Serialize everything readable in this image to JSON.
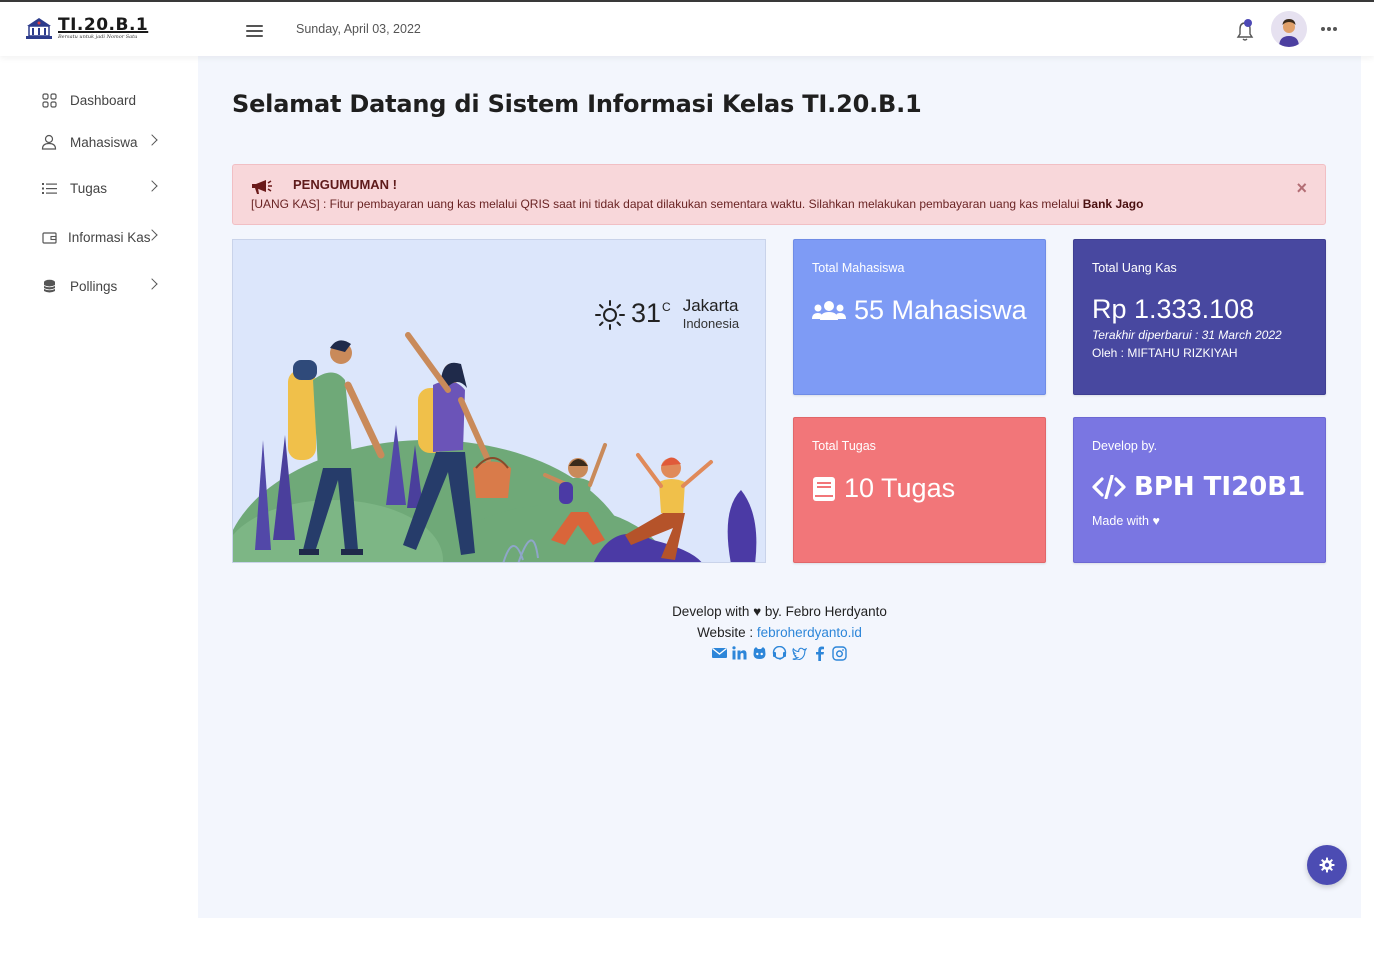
{
  "brand": {
    "title": "TI.20.B.1",
    "tagline": "Bersatu untuk jadi Nomor Satu"
  },
  "header": {
    "date": "Sunday, April 03, 2022"
  },
  "sidebar": {
    "items": [
      {
        "label": "Dashboard",
        "icon": "grid-icon"
      },
      {
        "label": "Mahasiswa",
        "icon": "user-icon"
      },
      {
        "label": "Tugas",
        "icon": "list-icon"
      },
      {
        "label": "Informasi Kas",
        "icon": "wallet-icon"
      },
      {
        "label": "Pollings",
        "icon": "database-icon"
      }
    ]
  },
  "main": {
    "title": "Selamat Datang di Sistem Informasi Kelas TI.20.B.1",
    "announcement": {
      "title": "PENGUMUMAN !",
      "text": "[UANG KAS] : Fitur pembayaran uang kas melalui QRIS saat ini tidak dapat dilakukan sementara waktu. Silahkan melakukan pembayaran uang kas melalui ",
      "highlight": "Bank Jago",
      "close": "×"
    },
    "weather": {
      "temp": "31",
      "unit": "C",
      "city": "Jakarta",
      "country": "Indonesia"
    },
    "cards": {
      "mahasiswa": {
        "label": "Total Mahasiswa",
        "value": "55 Mahasiswa",
        "color": "#7e9bf5"
      },
      "kas": {
        "label": "Total Uang Kas",
        "value": "Rp 1.333.108",
        "updated": "Terakhir diperbarui : 31 March 2022",
        "by": "Oleh : MIFTAHU RIZKIYAH",
        "color": "#4848a0"
      },
      "tugas": {
        "label": "Total Tugas",
        "value": "10 Tugas",
        "color": "#f27679"
      },
      "develop": {
        "label": "Develop by.",
        "value": "BPH TI20B1",
        "sub": "Made with ♥",
        "color": "#7a76e2"
      }
    }
  },
  "footer": {
    "line1": "Develop with ♥ by. Febro Herdyanto",
    "website_label": "Website : ",
    "website_link": "febroherdyanto.id",
    "social": [
      "envelope-icon",
      "linkedin-icon",
      "github-icon",
      "discord-icon",
      "twitter-icon",
      "facebook-icon",
      "instagram-icon"
    ]
  }
}
